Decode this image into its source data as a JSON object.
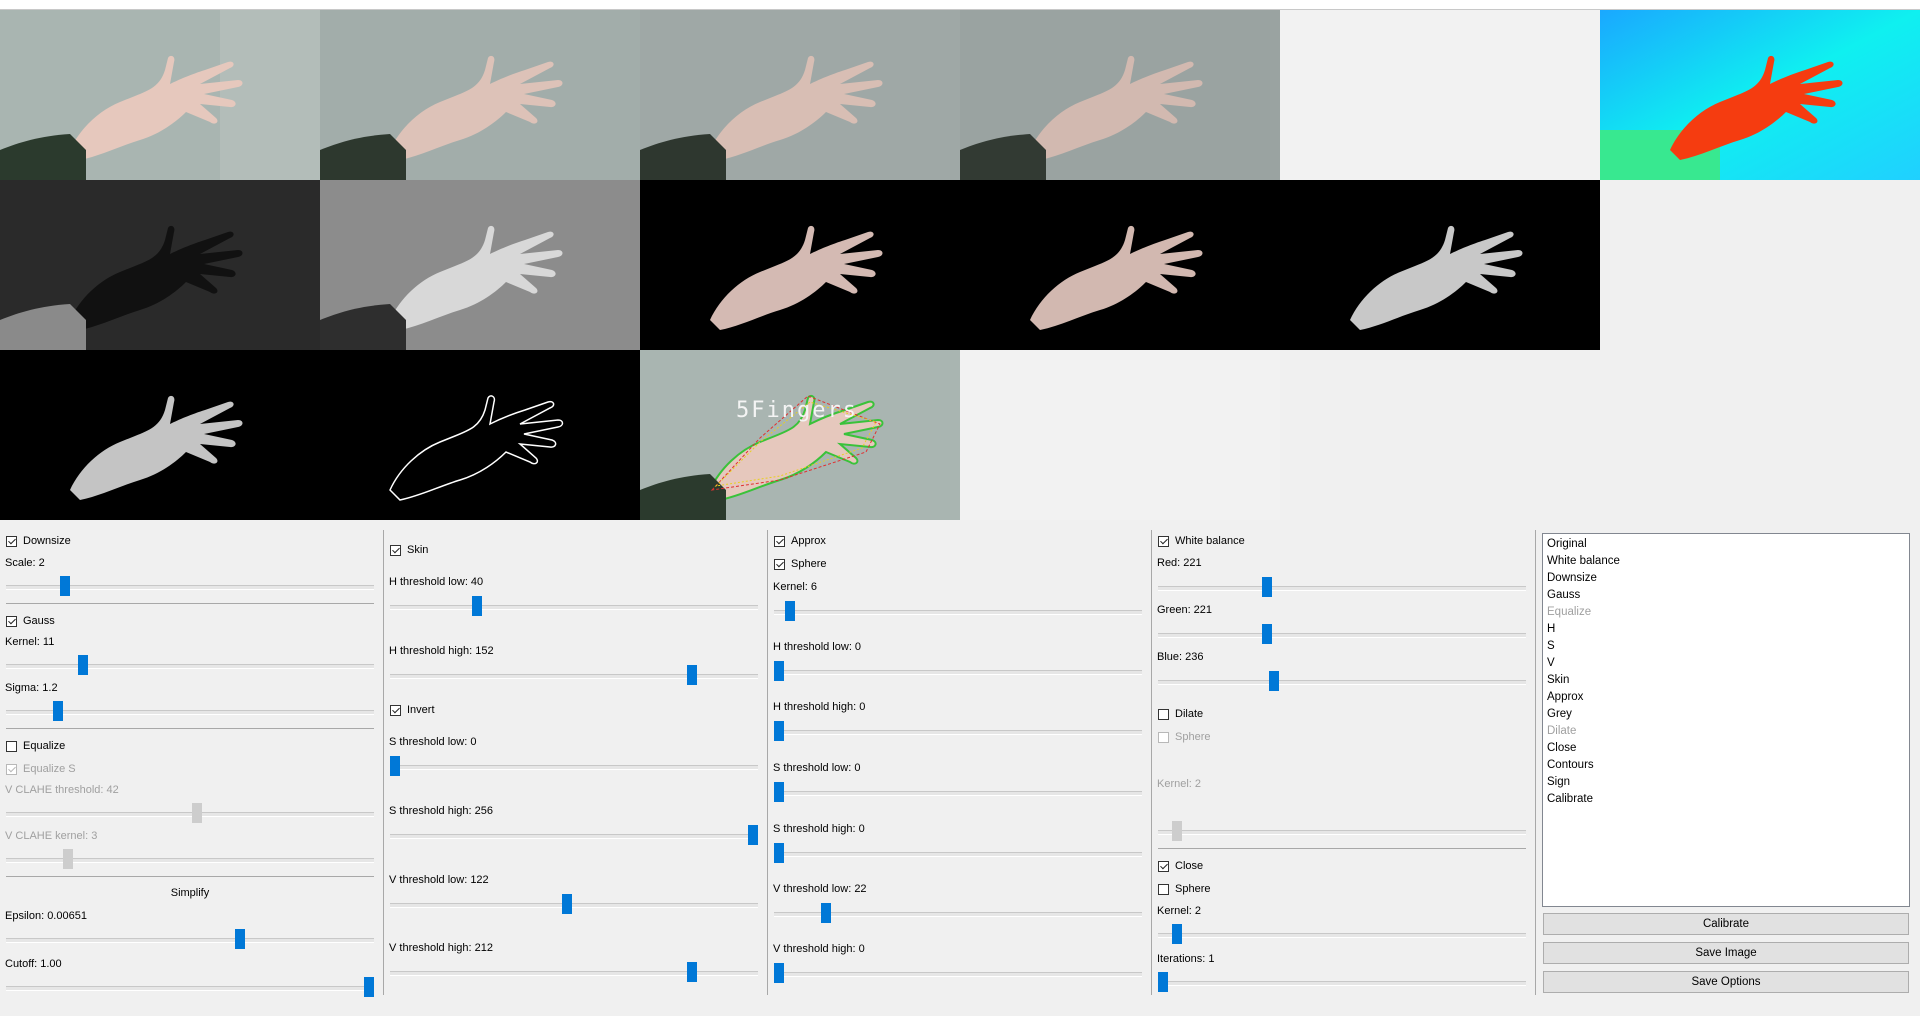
{
  "overlay_text": "5Fingers",
  "col1": {
    "downsize": {
      "label": "Downsize",
      "checked": true
    },
    "scale_label": "Scale: 2",
    "scale_value": 0.15,
    "gauss": {
      "label": "Gauss",
      "checked": true
    },
    "kernel_label": "Kernel: 11",
    "kernel_value": 0.2,
    "sigma_label": "Sigma: 1.2",
    "sigma_value": 0.13,
    "equalize": {
      "label": "Equalize",
      "checked": false
    },
    "equalize_s": {
      "label": "Equalize S",
      "checked": true
    },
    "clahe_threshold_label": "V CLAHE threshold: 42",
    "clahe_threshold_value": 0.52,
    "clahe_kernel_label": "V CLAHE kernel: 3",
    "clahe_kernel_value": 0.16,
    "simplify_title": "Simplify",
    "epsilon_label": "Epsilon: 0.00651",
    "epsilon_value": 0.64,
    "cutoff_label": "Cutoff: 1.00",
    "cutoff_value": 1.0
  },
  "col2": {
    "skin": {
      "label": "Skin",
      "checked": true
    },
    "h_low_label": "H threshold low: 40",
    "h_low_value": 0.23,
    "h_high_label": "H threshold high: 152",
    "h_high_value": 0.83,
    "invert": {
      "label": "Invert",
      "checked": true
    },
    "s_low_label": "S threshold low: 0",
    "s_low_value": 0.0,
    "s_high_label": "S threshold high: 256",
    "s_high_value": 1.0,
    "v_low_label": "V threshold low: 122",
    "v_low_value": 0.48,
    "v_high_label": "V threshold high: 212",
    "v_high_value": 0.83
  },
  "col3": {
    "approx": {
      "label": "Approx",
      "checked": true
    },
    "sphere": {
      "label": "Sphere",
      "checked": true
    },
    "kernel_label": "Kernel: 6",
    "kernel_value": 0.03,
    "h_low_label": "H threshold low: 0",
    "h_low_value": 0.0,
    "h_high_label": "H threshold high: 0",
    "h_high_value": 0.0,
    "s_low_label": "S threshold low: 0",
    "s_low_value": 0.0,
    "s_high_label": "S threshold high: 0",
    "s_high_value": 0.0,
    "v_low_label": "V threshold low: 22",
    "v_low_value": 0.13,
    "v_high_label": "V threshold high: 0",
    "v_high_value": 0.0
  },
  "col4": {
    "white_balance": {
      "label": "White balance",
      "checked": true
    },
    "red_label": "Red: 221",
    "red_value": 0.29,
    "green_label": "Green: 221",
    "green_value": 0.29,
    "blue_label": "Blue: 236",
    "blue_value": 0.31,
    "dilate": {
      "label": "Dilate",
      "checked": false
    },
    "dilate_sphere": {
      "label": "Sphere",
      "checked": false
    },
    "dilate_kernel_label": "Kernel: 2",
    "dilate_kernel_value": 0.04,
    "close": {
      "label": "Close",
      "checked": true
    },
    "close_sphere": {
      "label": "Sphere",
      "checked": false
    },
    "close_kernel_label": "Kernel: 2",
    "close_kernel_value": 0.04,
    "iterations_label": "Iterations: 1",
    "iterations_value": 0.0
  },
  "list_items": [
    {
      "label": "Original",
      "enabled": true
    },
    {
      "label": "White balance",
      "enabled": true
    },
    {
      "label": "Downsize",
      "enabled": true
    },
    {
      "label": "Gauss",
      "enabled": true
    },
    {
      "label": "Equalize",
      "enabled": false
    },
    {
      "label": "H",
      "enabled": true
    },
    {
      "label": "S",
      "enabled": true
    },
    {
      "label": "V",
      "enabled": true
    },
    {
      "label": "Skin",
      "enabled": true
    },
    {
      "label": "Approx",
      "enabled": true
    },
    {
      "label": "Grey",
      "enabled": true
    },
    {
      "label": "Dilate",
      "enabled": false
    },
    {
      "label": "Close",
      "enabled": true
    },
    {
      "label": "Contours",
      "enabled": true
    },
    {
      "label": "Sign",
      "enabled": true
    },
    {
      "label": "Calibrate",
      "enabled": true
    }
  ],
  "buttons": {
    "calibrate": "Calibrate",
    "save_image": "Save Image",
    "save_options": "Save Options"
  }
}
